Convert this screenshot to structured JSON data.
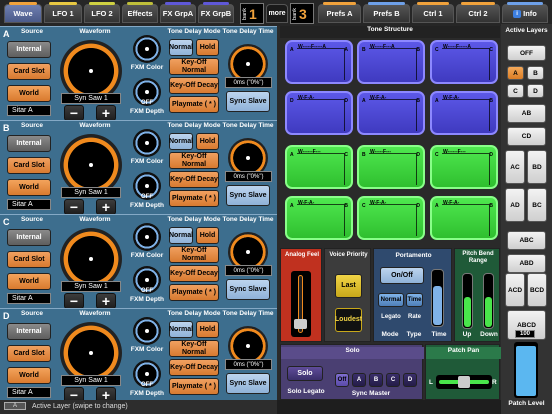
{
  "tabs": [
    {
      "label": "Wave",
      "strip": "#f0a23c",
      "selected": true
    },
    {
      "label": "LFO 1",
      "strip": "#e8c842",
      "selected": false
    },
    {
      "label": "LFO 2",
      "strip": "#cfd142",
      "selected": false
    },
    {
      "label": "Effects",
      "strip": "#bfbf3a",
      "selected": false
    },
    {
      "label": "FX GrpA",
      "strip": "#5f58d8",
      "selected": false
    },
    {
      "label": "FX GrpB",
      "strip": "#5f58d8",
      "selected": false
    }
  ],
  "bank_left": {
    "label": "bank",
    "value": "1"
  },
  "more_label": "more",
  "bank_right": {
    "label": "bank",
    "value": "3"
  },
  "top_tabs_right": [
    {
      "label": "Prefs A",
      "strip": "#f0a23c"
    },
    {
      "label": "Prefs B",
      "strip": "#6ea0e8"
    },
    {
      "label": "Ctrl 1",
      "strip": "#f0a23c"
    },
    {
      "label": "Ctrl 2",
      "strip": "#f0a23c"
    },
    {
      "label": "Info",
      "strip": "#6ea0e8"
    }
  ],
  "layer_sections": [
    {
      "letter": "A",
      "source_label": "Source",
      "waveform_label": "Waveform",
      "source_buttons": [
        "Internal",
        "Card Slot",
        "World"
      ],
      "selected_source": "World",
      "selected_name": "Sitar A",
      "wave_name": "Syn Saw 1",
      "fxm_color_label": "FXM Color",
      "fxm_depth_label": "FXM Depth",
      "fxm_depth_value": "OFF",
      "tone_delay_mode_label": "Tone Delay Mode",
      "tone_delay_time_label": "Tone Delay Time",
      "modes": [
        "Normal",
        "Hold",
        "Key-Off Normal",
        "Key-Off Decay",
        "Playmate ( * )"
      ],
      "time_value": "0ms (\"0%\")",
      "slave_label": "Sync Slave",
      "minus": "−",
      "plus": "+"
    },
    {
      "letter": "B",
      "source_label": "Source",
      "waveform_label": "Waveform",
      "source_buttons": [
        "Internal",
        "Card Slot",
        "World"
      ],
      "selected_source": "World",
      "selected_name": "Sitar A",
      "wave_name": "Syn Saw 1",
      "fxm_color_label": "FXM Color",
      "fxm_depth_label": "FXM Depth",
      "fxm_depth_value": "OFF",
      "tone_delay_mode_label": "Tone Delay Mode",
      "tone_delay_time_label": "Tone Delay Time",
      "modes": [
        "Normal",
        "Hold",
        "Key-Off Normal",
        "Key-Off Decay",
        "Playmate ( * )"
      ],
      "time_value": "0ms (\"0%\")",
      "slave_label": "Sync Slave",
      "minus": "−",
      "plus": "+"
    },
    {
      "letter": "C",
      "source_label": "Source",
      "waveform_label": "Waveform",
      "source_buttons": [
        "Internal",
        "Card Slot",
        "World"
      ],
      "selected_source": "World",
      "selected_name": "Sitar A",
      "wave_name": "Syn Saw 1",
      "fxm_color_label": "FXM Color",
      "fxm_depth_label": "FXM Depth",
      "fxm_depth_value": "OFF",
      "tone_delay_mode_label": "Tone Delay Mode",
      "tone_delay_time_label": "Tone Delay Time",
      "modes": [
        "Normal",
        "Hold",
        "Key-Off Normal",
        "Key-Off Decay",
        "Playmate ( * )"
      ],
      "time_value": "0ms (\"0%\")",
      "slave_label": "Sync Slave",
      "minus": "−",
      "plus": "+"
    },
    {
      "letter": "D",
      "source_label": "Source",
      "waveform_label": "Waveform",
      "source_buttons": [
        "Internal",
        "Card Slot",
        "World"
      ],
      "selected_source": "World",
      "selected_name": "Sitar A",
      "wave_name": "Syn Saw 1",
      "fxm_color_label": "FXM Color",
      "fxm_depth_label": "FXM Depth",
      "fxm_depth_value": "OFF",
      "tone_delay_mode_label": "Tone Delay Mode",
      "tone_delay_time_label": "Tone Delay Time",
      "modes": [
        "Normal",
        "Hold",
        "Key-Off Normal",
        "Key-Off Decay",
        "Playmate ( * )"
      ],
      "time_value": "0ms (\"0%\")",
      "slave_label": "Sync Slave",
      "minus": "−",
      "plus": "+"
    }
  ],
  "tone_structure": {
    "title": "Tone Structure",
    "blue": [
      {
        "l": "A",
        "r": "A",
        "a": "W-----F-----A"
      },
      {
        "l": "B",
        "r": "B",
        "a": "W-----F---A"
      },
      {
        "l": "C",
        "r": "C",
        "a": "W-----F-----A"
      },
      {
        "l": "D",
        "r": "D",
        "a": "W-F-A-"
      },
      {
        "l": "A",
        "r": "B",
        "a": "W-F-A-"
      },
      {
        "l": "A",
        "r": "B",
        "a": "W-F-A-"
      }
    ],
    "green": [
      {
        "l": "A",
        "r": "C",
        "a": "W------F---"
      },
      {
        "l": "B",
        "r": "D",
        "a": "W-----F---"
      },
      {
        "l": "C",
        "r": "D",
        "a": "W------F---"
      },
      {
        "l": "A",
        "r": "B",
        "a": "W-F-A-"
      },
      {
        "l": "C",
        "r": "D",
        "a": "W-F-A-"
      },
      {
        "l": "A",
        "r": "B",
        "a": "W-F-A-"
      }
    ]
  },
  "analog_feel": {
    "label": "Analog Feel",
    "level": 0.0
  },
  "voice_priority": {
    "label": "Voice Priority",
    "last": "Last",
    "loudest": "Loudest"
  },
  "portamento": {
    "label": "Portamento",
    "onoff": "On/Off",
    "normal": "Normal",
    "time_btn": "Time",
    "legato": "Legato",
    "rate": "Rate",
    "col_labels": [
      "Mode",
      "Type",
      "Time"
    ],
    "time_level": 0.7
  },
  "pitch_bend": {
    "label": "Pitch Bend Range",
    "up_label": "Up",
    "down_label": "Down",
    "up_level": 0.55,
    "down_level": 0.55
  },
  "solo": {
    "label": "Solo",
    "solo_btn": "Solo",
    "solo_legato": "Solo Legato",
    "sync_options": [
      "Off",
      "A",
      "B",
      "C",
      "D"
    ],
    "sync_label": "Sync Master"
  },
  "patch_pan": {
    "label": "Patch Pan",
    "l": "L",
    "r": "R"
  },
  "active_layers": {
    "label": "Active Layers",
    "off": "OFF",
    "singles": [
      "A",
      "B",
      "C",
      "D"
    ],
    "pairs": [
      "AB",
      "CD",
      "AC",
      "BD",
      "AD",
      "BC",
      "ABC",
      "ABD",
      "ACD",
      "BCD",
      "ABCD"
    ],
    "on": [
      "A"
    ]
  },
  "patch_level": {
    "label": "Patch Level",
    "value": "100",
    "level": 0.95
  },
  "status_bar": {
    "badge": "A",
    "text": "Active Layer (swipe to change)"
  },
  "colors": {
    "orange": "#f08a1e",
    "blue": "#7fb2e8",
    "section_bg": "#3d6e8e"
  }
}
